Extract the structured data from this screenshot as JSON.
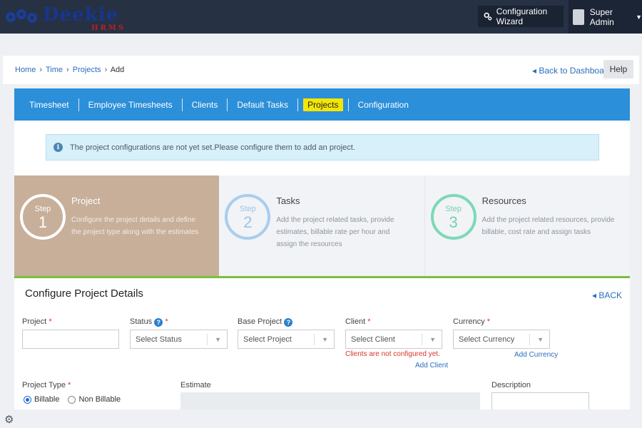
{
  "header": {
    "logo_text": "Deekie",
    "logo_sub": "HRMS",
    "wizard_label": "Configuration Wizard",
    "user_name": "Super Admin"
  },
  "breadcrumb": {
    "home": "Home",
    "time": "Time",
    "projects": "Projects",
    "current": "Add",
    "separator": "›"
  },
  "back_dashboard": "◂ Back to Dashboard",
  "help_label": "Help",
  "tabs": [
    {
      "label": "Timesheet",
      "active": false
    },
    {
      "label": "Employee Timesheets",
      "active": false
    },
    {
      "label": "Clients",
      "active": false
    },
    {
      "label": "Default Tasks",
      "active": false
    },
    {
      "label": "Projects",
      "active": true
    },
    {
      "label": "Configuration",
      "active": false
    }
  ],
  "alert_text": "The project configurations are not yet set.Please configure them to add an project.",
  "steps": [
    {
      "step_label": "Step",
      "number": "1",
      "title": "Project",
      "desc": "Configure the project details and define the project type along with the estimates"
    },
    {
      "step_label": "Step",
      "number": "2",
      "title": "Tasks",
      "desc": "Add the project related tasks, provide estimates, billable rate per hour and assign the resources"
    },
    {
      "step_label": "Step",
      "number": "3",
      "title": "Resources",
      "desc": "Add the project related resources, provide billable, cost rate and assign tasks"
    }
  ],
  "form": {
    "section_title": "Configure Project Details",
    "back_label": "◂ BACK",
    "project_label": "Project",
    "status_label": "Status",
    "status_placeholder": "Select Status",
    "base_project_label": "Base Project",
    "base_project_placeholder": "Select Project",
    "client_label": "Client",
    "client_placeholder": "Select Client",
    "client_error": "Clients are not configured yet.",
    "add_client": "Add Client",
    "currency_label": "Currency",
    "currency_placeholder": "Select Currency",
    "add_currency": "Add Currency",
    "project_type_label": "Project Type",
    "billable_label": "Billable",
    "non_billable_label": "Non Billable",
    "selected_type": "Billable",
    "estimate_label": "Estimate",
    "description_label": "Description",
    "required_mark": "*",
    "help_mark": "?"
  },
  "colors": {
    "header_bg": "#263143",
    "tab_bar": "#2b8fd9",
    "active_tab": "#f4e600",
    "step1_bg": "#c7af9a",
    "step_divider": "#7abf3e",
    "link": "#2a6ebd",
    "error": "#d9342b"
  }
}
